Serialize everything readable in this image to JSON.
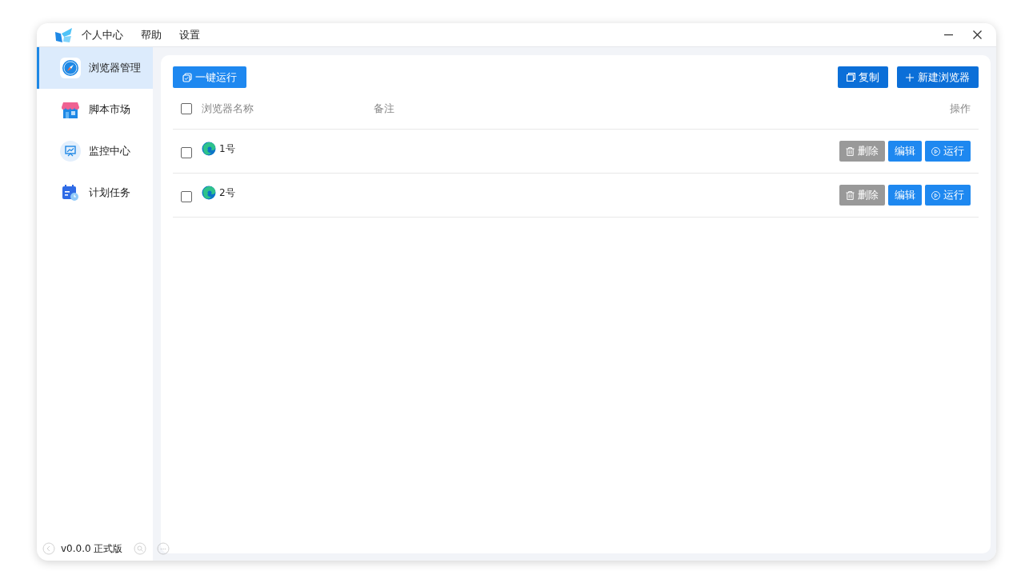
{
  "menu": [
    "个人中心",
    "帮助",
    "设置"
  ],
  "sidebar": {
    "items": [
      {
        "label": "浏览器管理",
        "kind": "compass",
        "selected": true
      },
      {
        "label": "脚本市场",
        "kind": "shop",
        "selected": false
      },
      {
        "label": "监控中心",
        "kind": "monitor",
        "selected": false
      },
      {
        "label": "计划任务",
        "kind": "calendar",
        "selected": false
      }
    ],
    "version": "v0.0.0 正式版"
  },
  "toolbar": {
    "run_all": "一键运行",
    "copy": "复制",
    "new": "新建浏览器"
  },
  "table": {
    "select_all_checked": false,
    "columns": [
      "浏览器名称",
      "备注",
      "操作"
    ],
    "rows": [
      {
        "name": "1号",
        "checked": false,
        "actions": [
          "删除",
          "编辑",
          "运行"
        ]
      },
      {
        "name": "2号",
        "checked": false,
        "actions": [
          "删除",
          "编辑",
          "运行"
        ]
      }
    ]
  }
}
